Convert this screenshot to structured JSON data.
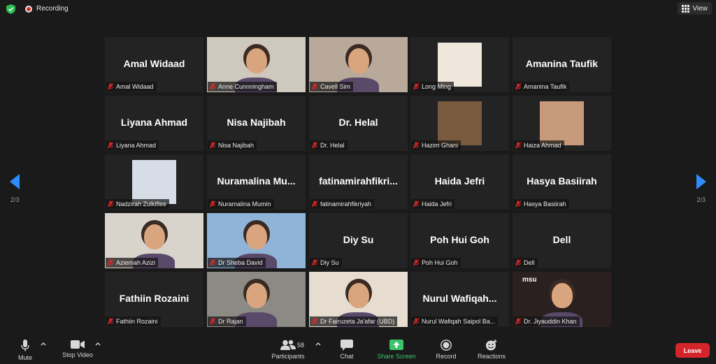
{
  "topbar": {
    "recording_label": "Recording",
    "view_label": "View"
  },
  "paging": {
    "left_page": "2/3",
    "right_page": "2/3"
  },
  "tiles": [
    {
      "display": "Amal Widaad",
      "label": "Amal Widaad",
      "video": false
    },
    {
      "display": "",
      "label": "Anne Cunnningham",
      "video": true,
      "bg": "#cfc8bc"
    },
    {
      "display": "",
      "label": "Cavell Sim",
      "video": true,
      "bg": "#b9a99a"
    },
    {
      "display": "",
      "label": "Long Ming",
      "video": "image",
      "bg": "#efe6dc"
    },
    {
      "display": "Amanina Taufik",
      "label": "Amanina Taufik",
      "video": false
    },
    {
      "display": "Liyana Ahmad",
      "label": "Liyana Ahmad",
      "video": false
    },
    {
      "display": "Nisa Najibah",
      "label": "Nisa Najibah",
      "video": false
    },
    {
      "display": "Dr. Helal",
      "label": "Dr. Helal",
      "video": false
    },
    {
      "display": "",
      "label": "Hazim Ghani",
      "video": "image",
      "bg": "#7a5a3e"
    },
    {
      "display": "",
      "label": "Haiza Ahmad",
      "video": "image",
      "bg": "#c89a7c"
    },
    {
      "display": "",
      "label": "Nadzirah Zulkiflee",
      "video": "image",
      "bg": "#d6dde6"
    },
    {
      "display": "Nuramalina  Mu...",
      "label": "Nuramalina Mumin",
      "video": false
    },
    {
      "display": "fatinamirahfikri...",
      "label": "fatinamirahfikriyah",
      "video": false
    },
    {
      "display": "Haida Jefri",
      "label": "Haida Jefri",
      "video": false
    },
    {
      "display": "Hasya Basiirah",
      "label": "Hasya Basiirah",
      "video": false
    },
    {
      "display": "",
      "label": "Aziemah Azizi",
      "video": true,
      "bg": "#d8d4cc"
    },
    {
      "display": "",
      "label": "Dr Sheba David",
      "video": true,
      "bg": "#8fb4d8"
    },
    {
      "display": "Diy Su",
      "label": "Diy Su",
      "video": false
    },
    {
      "display": "Poh Hui Goh",
      "label": "Poh Hui Goh",
      "video": false
    },
    {
      "display": "Dell",
      "label": "Dell",
      "video": false
    },
    {
      "display": "Fathiin Rozaini",
      "label": "Fathiin Rozaini",
      "video": false
    },
    {
      "display": "",
      "label": "Dr Rajan",
      "video": true,
      "bg": "#8c8a84"
    },
    {
      "display": "",
      "label": "Dr Fairuzeta Ja'afar (UBD)",
      "video": true,
      "bg": "#e6ddd0"
    },
    {
      "display": "Nurul  Wafiqah...",
      "label": "Nurul Wafiqah Saipol Ba...",
      "video": false
    },
    {
      "display": "",
      "label": "Dr. Jiyauddin Khan",
      "video": true,
      "bg": "#2a2020"
    }
  ],
  "logo_text": {
    "msu": "msu"
  },
  "toolbar": {
    "mute_label": "Mute",
    "stop_video_label": "Stop Video",
    "participants_label": "Participants",
    "participants_count": "58",
    "chat_label": "Chat",
    "share_label": "Share Screen",
    "record_label": "Record",
    "reactions_label": "Reactions",
    "leave_label": "Leave"
  },
  "colors": {
    "background": "#1a1a1a",
    "tile": "#232323",
    "share_green": "#3cc46b",
    "leave_red": "#d4262a",
    "paging_blue": "#2d8cff",
    "mic_off_red": "#e02828"
  }
}
